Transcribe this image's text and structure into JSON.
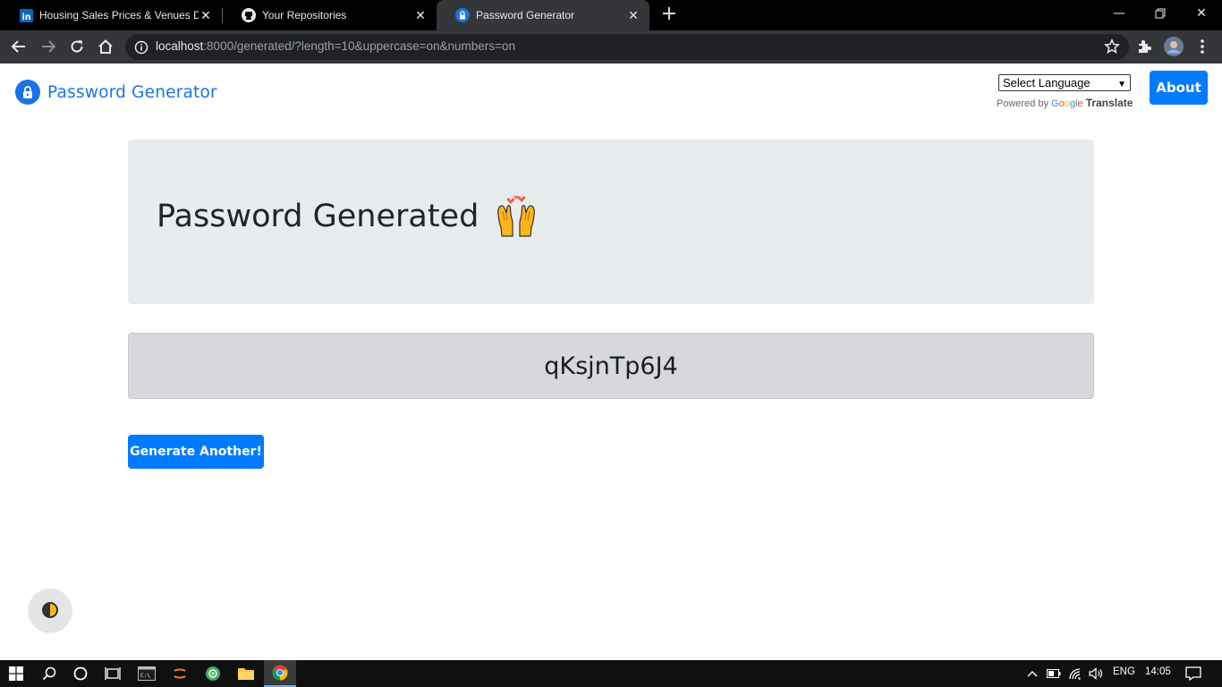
{
  "browser": {
    "tabs": [
      {
        "title": "Housing Sales Prices & Venues Data",
        "favicon": "linkedin-icon"
      },
      {
        "title": "Your Repositories",
        "favicon": "github-icon"
      },
      {
        "title": "Password Generator",
        "favicon": "lock-icon",
        "active": true
      }
    ],
    "url_host": "localhost",
    "url_rest": ":8000/generated/?length=10&uppercase=on&numbers=on"
  },
  "navbar": {
    "brand": "Password Generator",
    "language_select": "Select Language",
    "powered_by": "Powered by",
    "google": "Google",
    "translate": "Translate",
    "about": "About"
  },
  "main": {
    "heading": "Password Generated",
    "password": "qKsjnTp6J4",
    "generate_button": "Generate Another!"
  },
  "taskbar": {
    "language": "ENG",
    "time": "14:05"
  },
  "colors": {
    "primary": "#007bff",
    "jumbotron_bg": "#e9ecef",
    "password_bg": "#d6d8db"
  }
}
